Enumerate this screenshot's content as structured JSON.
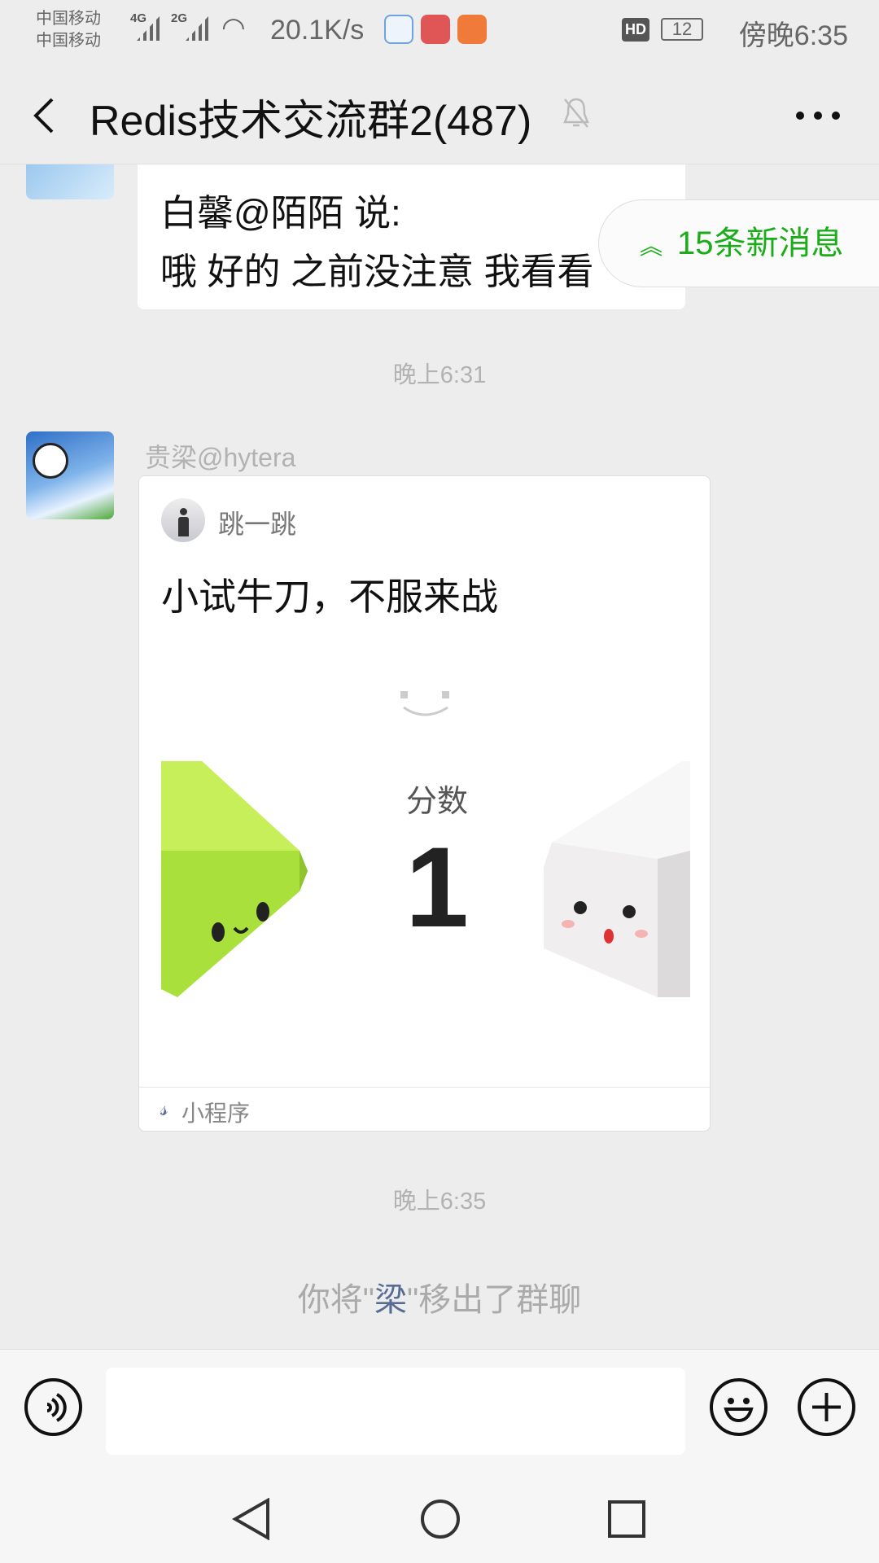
{
  "status_bar": {
    "carrier1": "中国移动",
    "carrier2": "中国移动",
    "net1": "4G",
    "net2": "2G",
    "speed": "20.1K/s",
    "hd": "HD",
    "battery": "12",
    "time": "傍晚6:35"
  },
  "header": {
    "title": "Redis技术交流群2(487)"
  },
  "messages": {
    "quote_line1": "白馨@陌陌 说:",
    "quote_line2": "哦  好的 之前没注意 我看看",
    "new_messages": "15条新消息",
    "time1": "晚上6:31",
    "sender": "贵梁@hytera",
    "card": {
      "app_name": "跳一跳",
      "title": "小试牛刀，不服来战",
      "score_label": "分数",
      "score": "1",
      "footer": "小程序"
    },
    "time2": "晚上6:35",
    "system_pre": "你将\"",
    "system_name": "梁",
    "system_post": "\"移出了群聊"
  },
  "colors": {
    "green": "#1aad19",
    "link": "#576b95",
    "bg": "#ededed"
  }
}
